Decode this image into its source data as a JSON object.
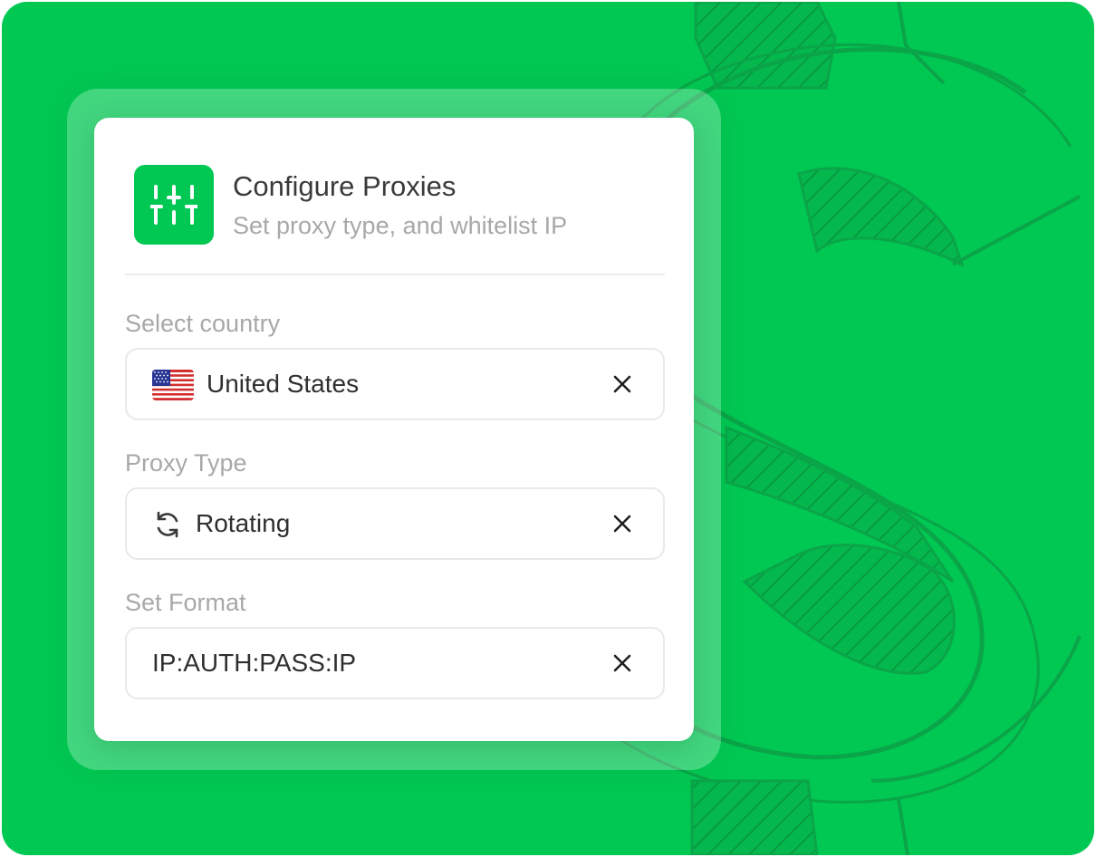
{
  "header": {
    "title": "Configure Proxies",
    "subtitle": "Set proxy type, and whitelist IP",
    "icon": "sliders-icon"
  },
  "fields": [
    {
      "label": "Select country",
      "value": "United States",
      "icon": "us-flag-icon",
      "clear_icon": "close-icon"
    },
    {
      "label": "Proxy Type",
      "value": "Rotating",
      "icon": "refresh-icon",
      "clear_icon": "close-icon"
    },
    {
      "label": "Set Format",
      "value": "IP:AUTH:PASS:IP",
      "clear_icon": "close-icon"
    }
  ],
  "colors": {
    "brand_green": "#00c853",
    "card_bg": "#ffffff",
    "label_gray": "#a8a8a8",
    "text_dark": "#2f2f2f"
  }
}
